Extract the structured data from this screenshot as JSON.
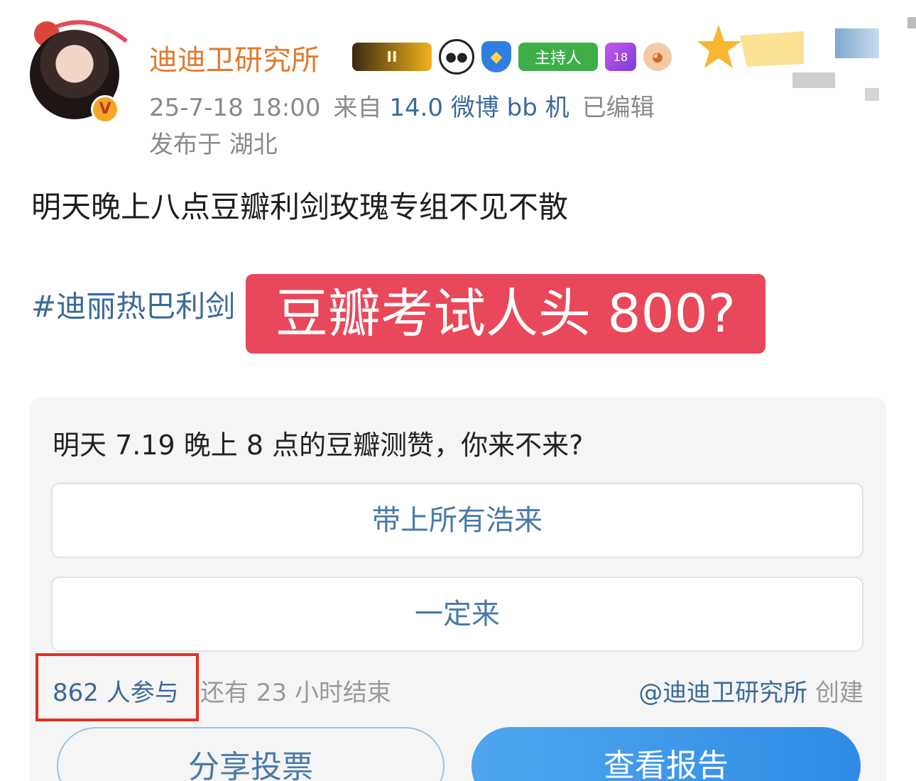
{
  "author": {
    "name": "迪迪卫研究所",
    "verified_badge": "V",
    "badges": [
      "crown-level-icon",
      "panda-icon",
      "shield-icon",
      "host-badge",
      "gem-level-icon",
      "pet-icon"
    ],
    "badge_texts": {
      "level": "II",
      "host": "主持人",
      "gem": "18"
    }
  },
  "meta": {
    "time": "25-7-18 18:00",
    "from_prefix": "来自",
    "source": "14.0 微博 bb 机",
    "edited": "已编辑",
    "location": "发布于 湖北"
  },
  "post": {
    "text": "明天晚上八点豆瓣利剑玫瑰专组不见不散",
    "hashtag": "#迪丽热巴利剑",
    "overlay_caption": "豆瓣考试人头 800?"
  },
  "poll": {
    "question": "明天 7.19 晚上 8 点的豆瓣测赞，你来不来?",
    "options": [
      {
        "label": "带上所有浩来"
      },
      {
        "label": "一定来"
      }
    ],
    "participants": "862 人参与",
    "remaining": "还有 23 小时结束",
    "creator_at": "@迪迪卫研究所",
    "creator_suffix": " 创建",
    "share_label": "分享投票",
    "report_label": "查看报告"
  },
  "colors": {
    "username": "#e07a2c",
    "link": "#3b6a9a",
    "overlay_bg": "#e8485a",
    "highlight_box": "#e2301f",
    "report_button": "#2f8be6"
  }
}
